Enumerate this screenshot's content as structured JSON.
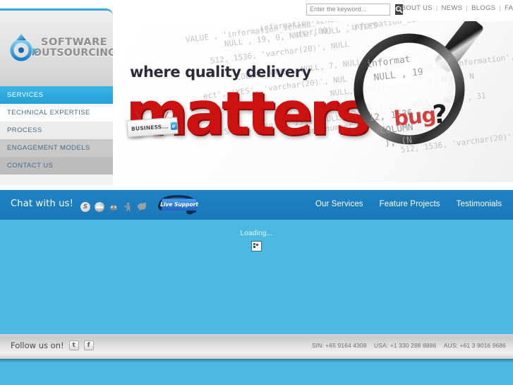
{
  "topbar": {
    "search": {
      "placeholder": "Enter the keyword...",
      "value": "",
      "button_icon": "search-icon"
    },
    "nav": [
      {
        "label": "ABOUT US"
      },
      {
        "label": "NEWS"
      },
      {
        "label": "BLOGS"
      },
      {
        "label": "FAQS"
      }
    ],
    "separator": "|"
  },
  "logo": {
    "line1": "SOFTWARE",
    "line2": "OUTSOURCING"
  },
  "sidebar": {
    "items": [
      {
        "label": "SERVICES",
        "active": true
      },
      {
        "label": "TECHNICAL EXPERTISE",
        "active": false
      },
      {
        "label": "PROCESS",
        "active": false
      },
      {
        "label": "ENGAGEMENT MODELS",
        "active": false
      },
      {
        "label": "CONTACT US",
        "active": false
      }
    ]
  },
  "banner": {
    "headline": "where quality delivery",
    "word": "matters",
    "tag_text": "BUSINESS...",
    "tag_icon": "ie-browser-icon",
    "bug_word": "bug",
    "bug_mark": "?",
    "code_lines": [
      "information_schema', 'YES', 'EVE",
      "NULL , 19, 0, NULL , NULL , FILES",
      "512, 1536, 'varchar(20)', NULL",
      "'COLUMN_NAME', NULL, 7, NULL",
      "char(80) , 'information_schema'",
      "NULL, 'information', 5, NULL, N",
      "SIZE ,! 18, 'NULL , NULL , 31",
      "ect', 'YES', 'varchar(20)', NUL",
      "VALUE , 'information_schema'",
      "'gen_number', 429, NULL, 'ty",
      "SAGE', 'NULL , 1536, NULL , 'i"
    ]
  },
  "chatbar": {
    "label": "Chat with us!",
    "icons": [
      {
        "name": "skype-icon",
        "glyph": "S"
      },
      {
        "name": "msn-messenger-icon",
        "glyph": ""
      },
      {
        "name": "yahoo-messenger-icon",
        "glyph": "☺"
      },
      {
        "name": "aim-messenger-icon",
        "glyph": "Ὣ6"
      },
      {
        "name": "chat-bubble-icon",
        "glyph": "💬"
      }
    ],
    "live_support_label": "Live Support",
    "nav": [
      {
        "label": "Our Services"
      },
      {
        "label": "Feature Projects"
      },
      {
        "label": "Testimonials"
      }
    ]
  },
  "content": {
    "loading_text": "Loading...",
    "placeholder_icon": "broken-image-icon"
  },
  "footer": {
    "follow_label": "Follow us on!",
    "social": [
      {
        "name": "twitter-icon",
        "glyph": "t"
      },
      {
        "name": "facebook-icon",
        "glyph": "f"
      }
    ],
    "phones": [
      {
        "label": "SIN: +65 9164 4308"
      },
      {
        "label": "USA: +1 330 288 8886"
      },
      {
        "label": "AUS: +61 3 9016 9686"
      }
    ]
  },
  "colors": {
    "accent_blue": "#39a9dc",
    "dark_blue_bar": "#1f83c4",
    "content_blue": "#4bb9e2",
    "red": "#cc1111"
  }
}
